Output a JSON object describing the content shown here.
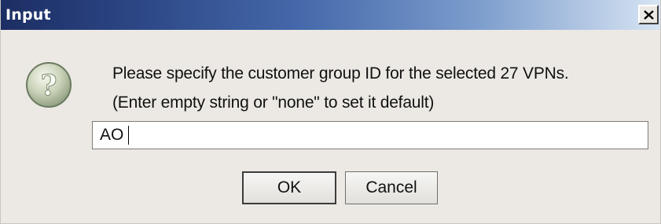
{
  "window": {
    "title": "Input",
    "close_label": "✕"
  },
  "icon": {
    "name": "question-icon",
    "glyph": "?"
  },
  "message": {
    "line1": "Please specify the customer group ID for  the selected 27 VPNs.",
    "line2": "(Enter empty string or \"none\" to set it default)"
  },
  "input": {
    "value": "AO"
  },
  "buttons": {
    "ok_label": "OK",
    "cancel_label": "Cancel"
  },
  "colors": {
    "titlebar_start": "#1c2e63",
    "titlebar_end": "#d7e4f3",
    "dialog_background": "#ece9e4"
  }
}
